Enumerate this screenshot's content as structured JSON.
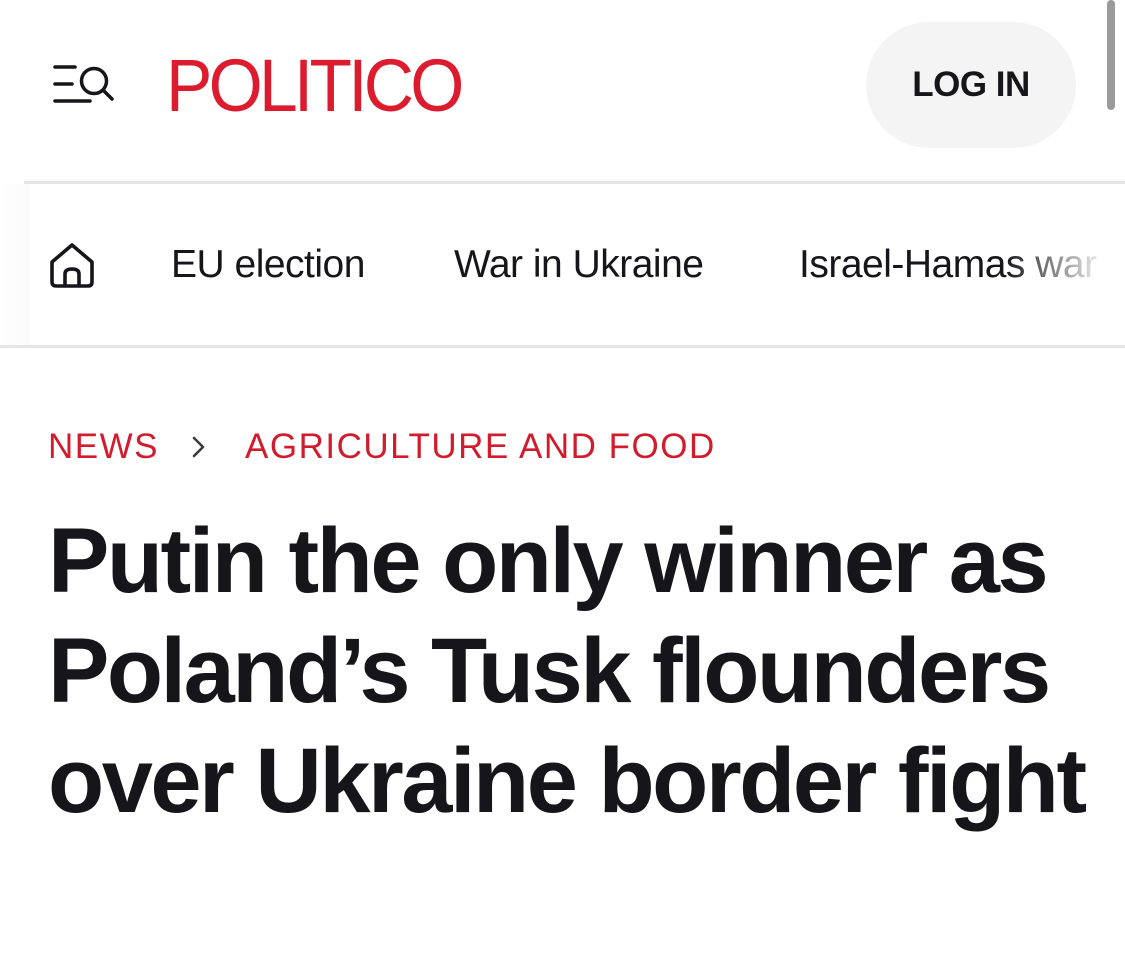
{
  "header": {
    "menu_icon": "menu-search-icon",
    "logo_text": "POLITICO",
    "login_label": "LOG IN"
  },
  "nav": {
    "home_icon": "home-icon",
    "items": [
      {
        "label": "EU election"
      },
      {
        "label": "War in Ukraine"
      },
      {
        "label": "Israel-Hamas war"
      }
    ]
  },
  "breadcrumb": {
    "section": "NEWS",
    "separator_icon": "chevron-right-icon",
    "topic": "AGRICULTURE AND FOOD"
  },
  "article": {
    "headline": "Putin the only winner as Poland’s Tusk flounders over Ukraine border fight"
  },
  "colors": {
    "brand_red": "#dc1c2e",
    "text": "#16151a",
    "button_bg": "#f4f4f4",
    "divider": "#e5e5e5"
  }
}
